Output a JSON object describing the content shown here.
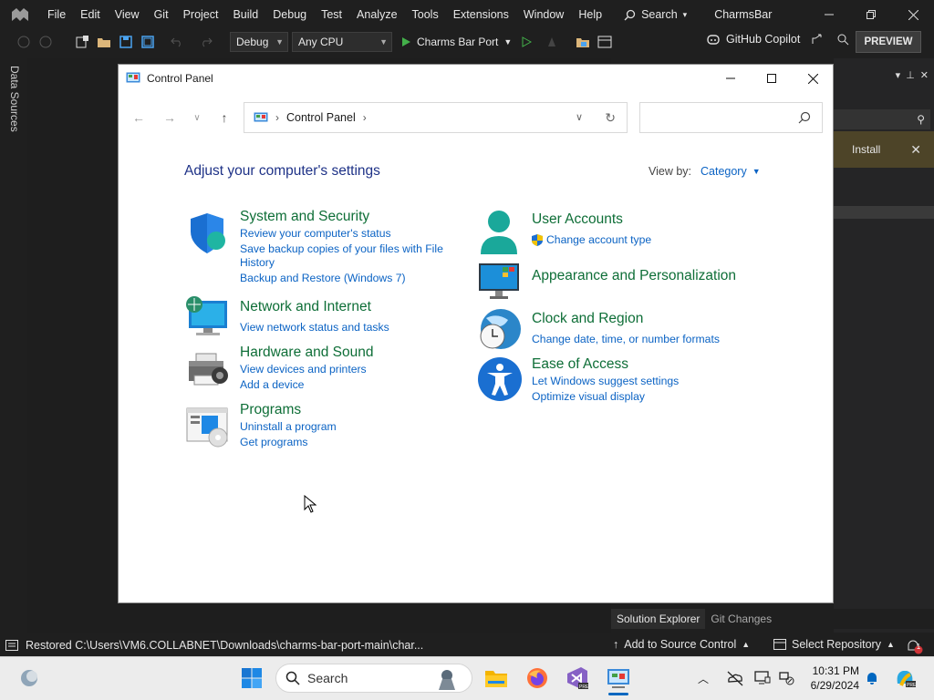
{
  "vs": {
    "menu": [
      "File",
      "Edit",
      "View",
      "Git",
      "Project",
      "Build",
      "Debug",
      "Test",
      "Analyze",
      "Tools",
      "Extensions",
      "Window",
      "Help"
    ],
    "search_label": "Search",
    "solution_name": "CharmsBar",
    "toolbar": {
      "config": "Debug",
      "platform": "Any CPU",
      "run_target": "Charms Bar Port",
      "copilot": "GitHub Copilot",
      "preview": "PREVIEW"
    },
    "left_panel": "Data Sources",
    "install_label": "Install",
    "tabs": [
      "Solution Explorer",
      "Git Changes"
    ],
    "status": {
      "message": "Restored C:\\Users\\VM6.COLLABNET\\Downloads\\charms-bar-port-main\\char...",
      "add_source": "Add to Source Control",
      "select_repo": "Select Repository",
      "notification_count": "1"
    }
  },
  "control_panel": {
    "window_title": "Control Panel",
    "breadcrumb": "Control Panel",
    "search_placeholder": "",
    "heading": "Adjust your computer's settings",
    "view_by_label": "View by:",
    "view_by_value": "Category",
    "categories": [
      {
        "title": "System and Security",
        "links": [
          "Review your computer's status",
          "Save backup copies of your files with File",
          "History",
          "Backup and Restore (Windows 7)"
        ],
        "icon": "shield-icon"
      },
      {
        "title": "Network and Internet",
        "links": [
          "View network status and tasks"
        ],
        "icon": "network-icon"
      },
      {
        "title": "Hardware and Sound",
        "links": [
          "View devices and printers",
          "Add a device"
        ],
        "icon": "printer-icon"
      },
      {
        "title": "Programs",
        "links": [
          "Uninstall a program",
          "Get programs"
        ],
        "icon": "programs-icon"
      },
      {
        "title": "User Accounts",
        "links": [
          "Change account type"
        ],
        "icon": "user-icon"
      },
      {
        "title": "Appearance and Personalization",
        "links": [],
        "icon": "monitor-icon"
      },
      {
        "title": "Clock and Region",
        "links": [
          "Change date, time, or number formats"
        ],
        "icon": "clock-globe-icon"
      },
      {
        "title": "Ease of Access",
        "links": [
          "Let Windows suggest settings",
          "Optimize visual display"
        ],
        "icon": "accessibility-icon"
      }
    ]
  },
  "taskbar": {
    "search_placeholder": "Search",
    "time": "10:31 PM",
    "date": "6/29/2024"
  },
  "colors": {
    "category_title": "#0e6e37",
    "link": "#0b63c4",
    "heading": "#1e3287",
    "vs_background": "#1f1f1f"
  }
}
